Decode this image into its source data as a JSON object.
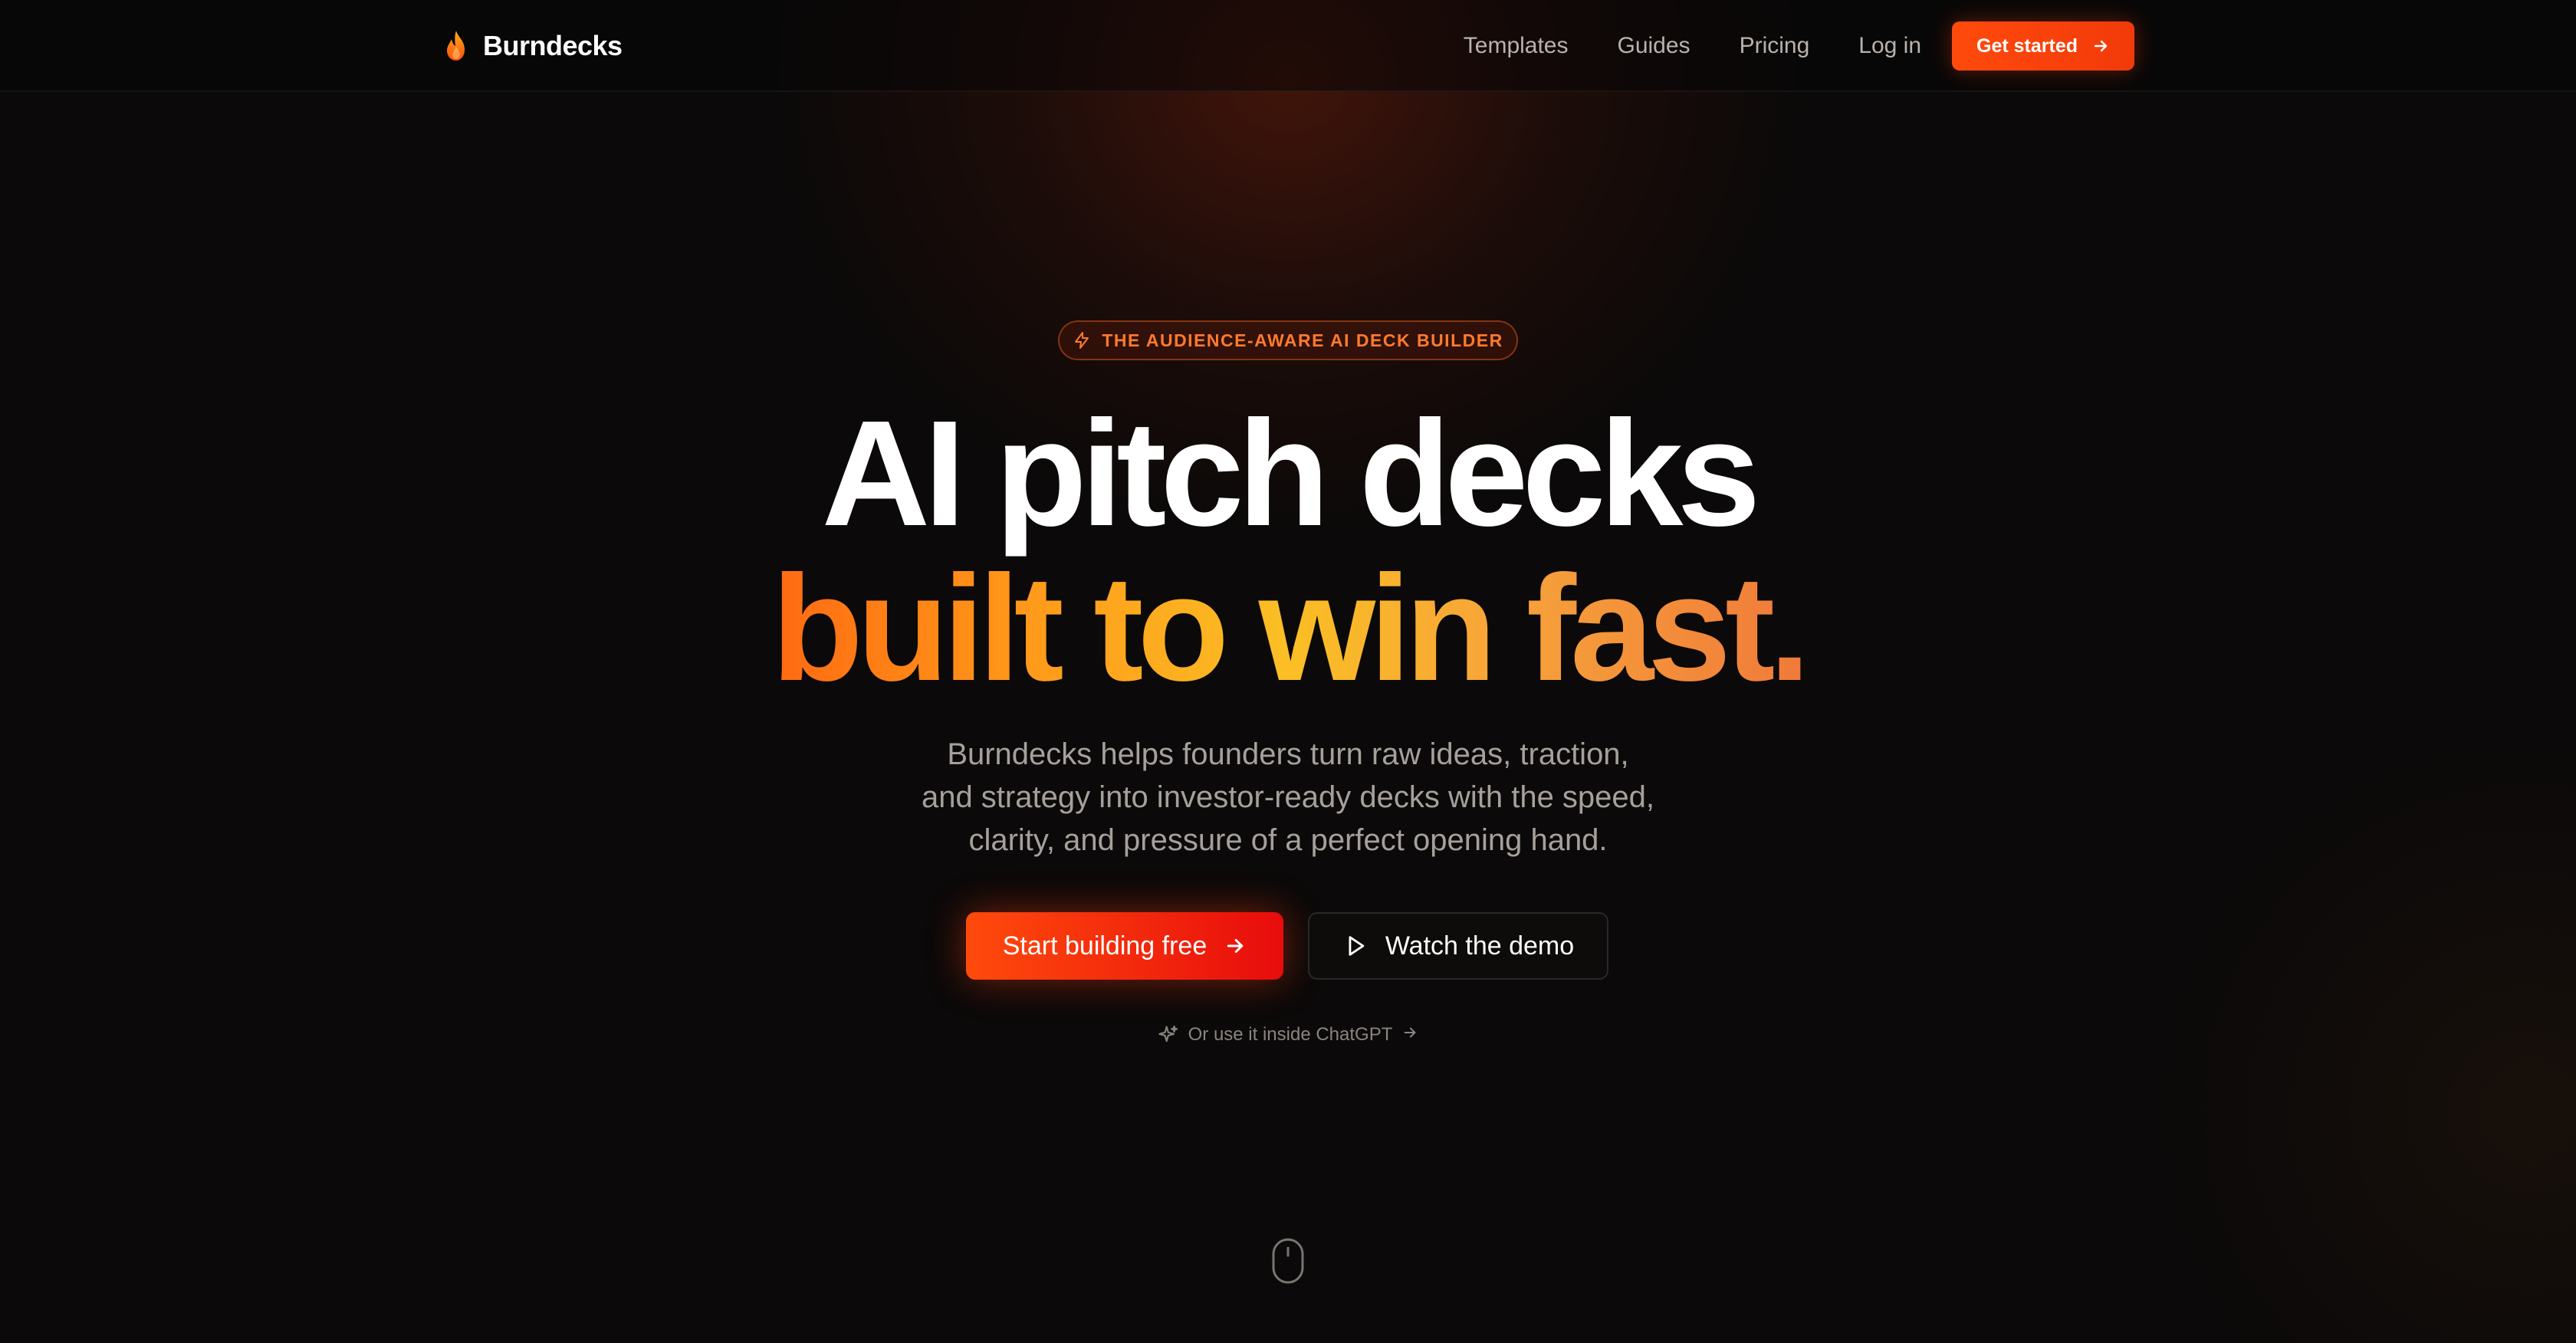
{
  "header": {
    "brand_name": "Burndecks",
    "nav": {
      "templates": "Templates",
      "guides": "Guides",
      "pricing": "Pricing",
      "login": "Log in"
    },
    "cta_label": "Get started"
  },
  "hero": {
    "badge": "THE AUDIENCE-AWARE AI DECK BUILDER",
    "headline_line1": "AI pitch decks",
    "headline_line2": "built to win fast.",
    "subtitle_line1": "Burndecks helps founders turn raw ideas, traction,",
    "subtitle_line2": "and strategy into investor-ready decks with the speed,",
    "subtitle_line3": "clarity, and pressure of a perfect opening hand.",
    "primary_cta": "Start building free",
    "secondary_cta": "Watch the demo",
    "chatgpt_link": "Or use it inside ChatGPT"
  },
  "colors": {
    "background": "#0b0909",
    "accent": "#ff4a0c",
    "headline_gradient_start": "#ff6a12",
    "headline_gradient_mid": "#fbbf24",
    "headline_gradient_end": "#f07a3a",
    "muted_text": "#a6a09b"
  },
  "icons": {
    "brand": "flame-icon",
    "badge": "lightning-icon",
    "cta_arrow": "arrow-right-icon",
    "demo": "play-icon",
    "chatgpt": "sparkle-icon",
    "scroll": "mouse-scroll-icon"
  }
}
